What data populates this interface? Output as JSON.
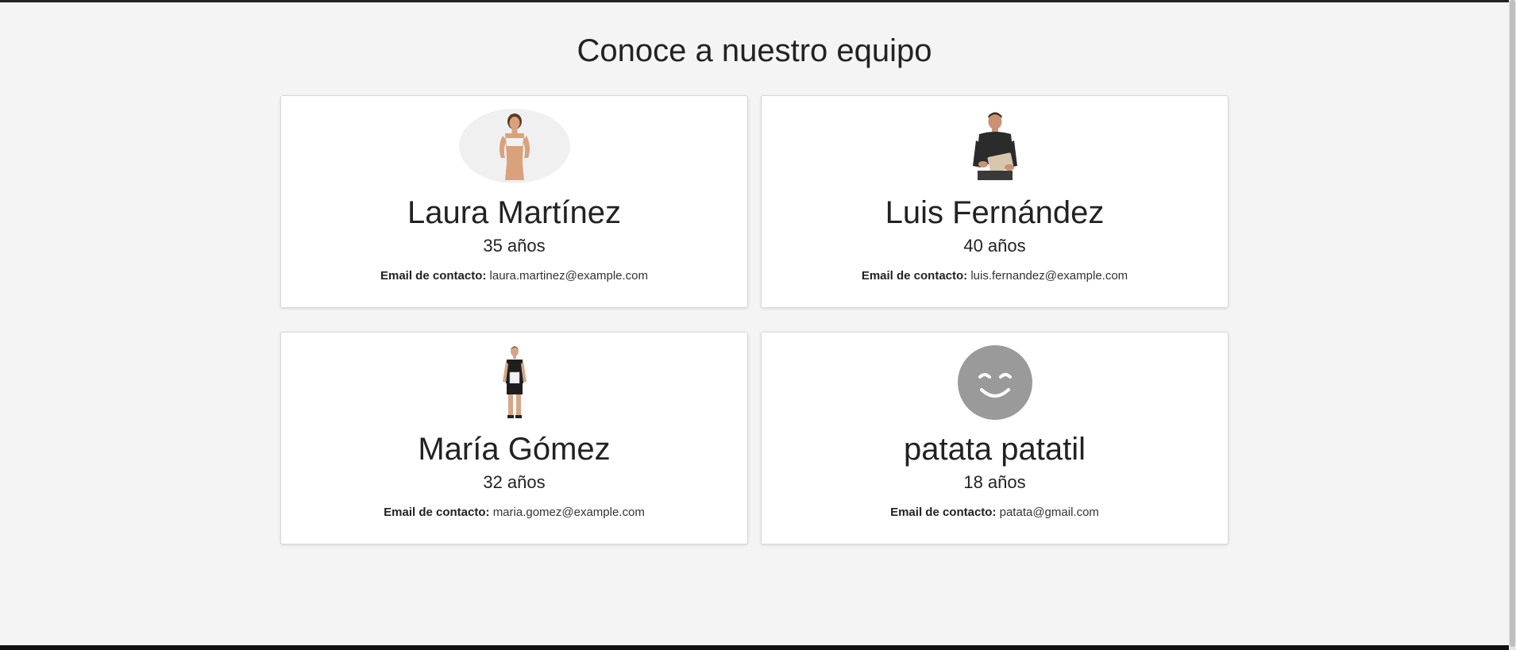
{
  "page": {
    "title": "Conoce a nuestro equipo"
  },
  "team": [
    {
      "name": "Laura Martínez",
      "age": "35 años",
      "email_label": "Email de contacto:",
      "email": "laura.martinez@example.com",
      "photo_icon": "woman-trainer-photo"
    },
    {
      "name": "Luis Fernández",
      "age": "40 años",
      "email_label": "Email de contacto:",
      "email": "luis.fernandez@example.com",
      "photo_icon": "man-trainer-photo"
    },
    {
      "name": "María Gómez",
      "age": "32 años",
      "email_label": "Email de contacto:",
      "email": "maria.gomez@example.com",
      "photo_icon": "woman-clipboard-photo"
    },
    {
      "name": "patata patatil",
      "age": "18 años",
      "email_label": "Email de contacto:",
      "email": "patata@gmail.com",
      "photo_icon": "smiley-avatar-icon"
    }
  ],
  "colors": {
    "background": "#f4f4f4",
    "card": "#ffffff",
    "avatar_gray": "#9a9a9a"
  }
}
